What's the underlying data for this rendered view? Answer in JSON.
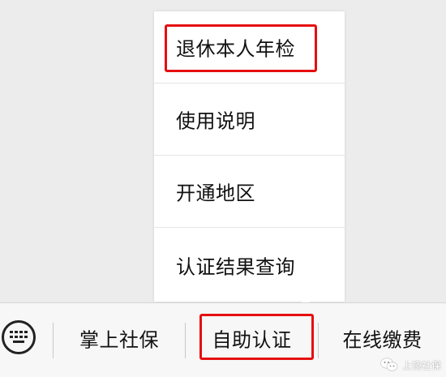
{
  "popup_menu": {
    "items": [
      {
        "label": "退休本人年检",
        "highlighted": true
      },
      {
        "label": "使用说明",
        "highlighted": false
      },
      {
        "label": "开通地区",
        "highlighted": false
      },
      {
        "label": "认证结果查询",
        "highlighted": false
      }
    ]
  },
  "bottom_bar": {
    "keyboard_icon": "keyboard-icon",
    "items": [
      {
        "label": "掌上社保",
        "highlighted": false
      },
      {
        "label": "自助认证",
        "highlighted": true
      },
      {
        "label": "在线缴费",
        "highlighted": false
      }
    ]
  },
  "watermark": {
    "icon": "wechat-icon",
    "text": "上饶社保"
  },
  "colors": {
    "highlight_border": "#e60f0f",
    "background": "#ececec",
    "menu_background": "#ffffff",
    "bar_background": "#f7f7f7"
  }
}
